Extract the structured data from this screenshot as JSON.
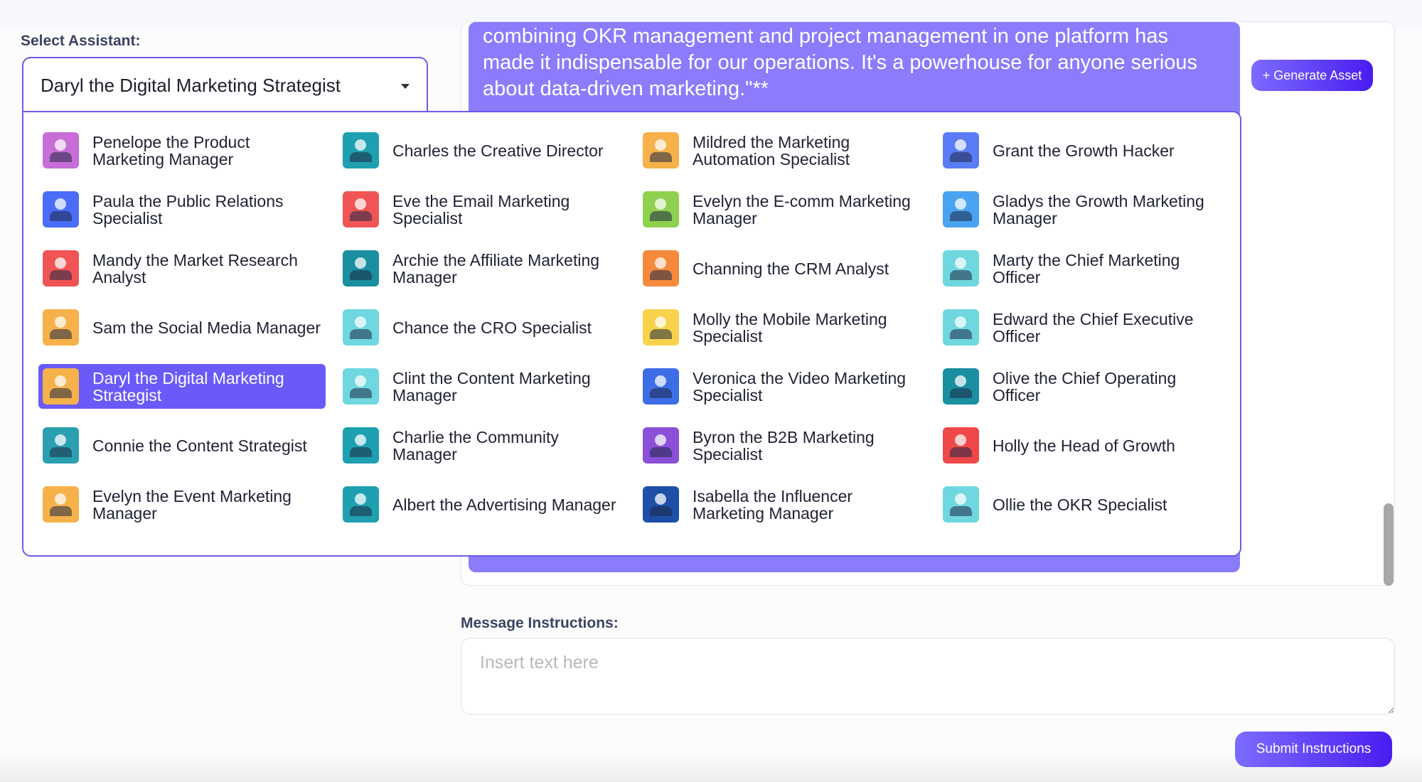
{
  "select_label": "Select Assistant:",
  "selected_assistant": "Daryl the Digital Marketing Strategist",
  "message_lines": [
    "combining OKR management and project management in one platform has",
    "made it indispensable for our operations. It's a powerhouse for anyone serious",
    "about data-driven marketing.\"**"
  ],
  "generate_label": "+ Generate Asset",
  "instructions_label": "Message Instructions:",
  "instructions_placeholder": "Insert text here",
  "submit_label": "Submit Instructions",
  "assistants": [
    [
      {
        "name": "Penelope the Product Marketing Manager",
        "color": "#c86dd7"
      },
      {
        "name": "Paula the Public Relations Specialist",
        "color": "#4a6cf7"
      },
      {
        "name": "Mandy the Market Research Analyst",
        "color": "#f05454"
      },
      {
        "name": "Sam the Social Media Manager",
        "color": "#f6b14a"
      },
      {
        "name": "Daryl the Digital Marketing Strategist",
        "color": "#f6b14a",
        "selected": true
      },
      {
        "name": "Connie the Content Strategist",
        "color": "#2a9fb0"
      },
      {
        "name": "Evelyn the Event Marketing Manager",
        "color": "#f6b14a"
      }
    ],
    [
      {
        "name": "Charles the Creative Director",
        "color": "#1ea0b0"
      },
      {
        "name": "Eve the Email Marketing Specialist",
        "color": "#f05454"
      },
      {
        "name": "Archie the Affiliate Marketing Manager",
        "color": "#1a8fa0"
      },
      {
        "name": "Chance the CRO Specialist",
        "color": "#6fd7df"
      },
      {
        "name": "Clint the Content Marketing Manager",
        "color": "#6fd7df"
      },
      {
        "name": "Charlie the Community Manager",
        "color": "#1ea0b0"
      },
      {
        "name": "Albert the Advertising Manager",
        "color": "#1ea0b0"
      }
    ],
    [
      {
        "name": "Mildred the Marketing Automation Specialist",
        "color": "#f6b14a"
      },
      {
        "name": "Evelyn the E-comm Marketing Manager",
        "color": "#8fd14f"
      },
      {
        "name": "Channing the CRM Analyst",
        "color": "#f58a3c"
      },
      {
        "name": "Molly the Mobile Marketing Specialist",
        "color": "#f8d24a"
      },
      {
        "name": "Veronica the Video Marketing Specialist",
        "color": "#3d6ee8"
      },
      {
        "name": "Byron the B2B Marketing Specialist",
        "color": "#8b4fd8"
      },
      {
        "name": "Isabella the Influencer Marketing Manager",
        "color": "#1d4fa8"
      }
    ],
    [
      {
        "name": "Grant the Growth Hacker",
        "color": "#5b7cf7"
      },
      {
        "name": "Gladys the Growth Marketing Manager",
        "color": "#4aa3f0"
      },
      {
        "name": "Marty the Chief Marketing Officer",
        "color": "#6fd7df"
      },
      {
        "name": "Edward the Chief Executive Officer",
        "color": "#6fd7df"
      },
      {
        "name": "Olive the Chief Operating Officer",
        "color": "#1a8fa0"
      },
      {
        "name": "Holly the Head of Growth",
        "color": "#f04848"
      },
      {
        "name": "Ollie the OKR Specialist",
        "color": "#6fd7df"
      }
    ]
  ]
}
